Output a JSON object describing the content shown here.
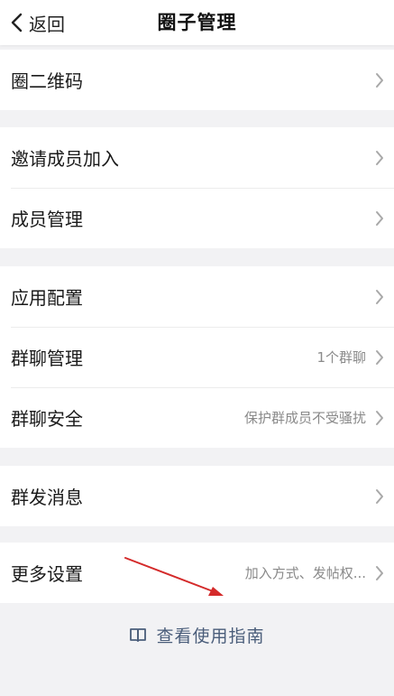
{
  "header": {
    "back_label": "返回",
    "title": "圈子管理"
  },
  "sections": [
    {
      "rows": [
        {
          "label": "圈二维码",
          "value": ""
        }
      ]
    },
    {
      "rows": [
        {
          "label": "邀请成员加入",
          "value": ""
        },
        {
          "label": "成员管理",
          "value": ""
        }
      ]
    },
    {
      "rows": [
        {
          "label": "应用配置",
          "value": ""
        },
        {
          "label": "群聊管理",
          "value": "1个群聊"
        },
        {
          "label": "群聊安全",
          "value": "保护群成员不受骚扰"
        }
      ]
    },
    {
      "rows": [
        {
          "label": "群发消息",
          "value": ""
        }
      ]
    },
    {
      "rows": [
        {
          "label": "更多设置",
          "value": "加入方式、发帖权..."
        }
      ]
    }
  ],
  "guide": {
    "label": "查看使用指南",
    "icon": "book-icon"
  },
  "colors": {
    "background": "#f2f2f4",
    "row_background": "#ffffff",
    "secondary_text": "#8a8a8a",
    "guide_text": "#4a5d7a",
    "annotation_arrow": "#d42a2a"
  }
}
